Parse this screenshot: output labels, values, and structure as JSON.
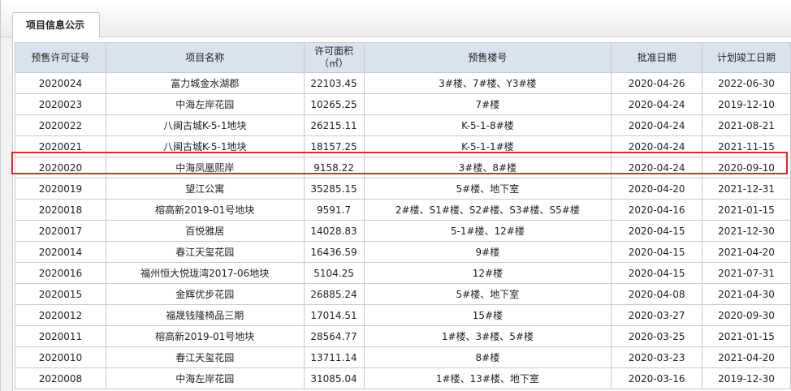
{
  "tab": {
    "label": "项目信息公示"
  },
  "table": {
    "headers": [
      "预售许可证号",
      "项目名称",
      "许可面积\n（㎡）",
      "预售楼号",
      "批准日期",
      "计划竣工日期"
    ],
    "rows": [
      [
        "2020024",
        "富力城金水湖郡",
        "22103.45",
        "3#楼、7#楼、Y3#楼",
        "2020-04-26",
        "2022-06-30"
      ],
      [
        "2020023",
        "中海左岸花园",
        "10265.25",
        "7#楼",
        "2020-04-24",
        "2019-12-10"
      ],
      [
        "2020022",
        "八闽古城K-5-1地块",
        "26215.11",
        "K-5-1-8#楼",
        "2020-04-24",
        "2021-08-21"
      ],
      [
        "2020021",
        "八闽古城K-5-1地块",
        "18157.25",
        "K-5-1-1#楼",
        "2020-04-24",
        "2021-11-15"
      ],
      [
        "2020020",
        "中海凤凰熙岸",
        "9158.22",
        "3#楼、8#楼",
        "2020-04-24",
        "2020-09-10"
      ],
      [
        "2020019",
        "望江公寓",
        "35285.15",
        "5#楼、地下室",
        "2020-04-20",
        "2021-12-31"
      ],
      [
        "2020018",
        "榕高新2019-01号地块",
        "9591.7",
        "2#楼、S1#楼、S2#楼、S3#楼、S5#楼",
        "2020-04-16",
        "2021-01-15"
      ],
      [
        "2020017",
        "百悦雅居",
        "14028.83",
        "5-1#楼、12#楼",
        "2020-04-15",
        "2021-12-30"
      ],
      [
        "2020014",
        "春江天玺花园",
        "16436.59",
        "9#楼",
        "2020-04-15",
        "2021-04-20"
      ],
      [
        "2020016",
        "福州恒大悦珑湾2017-06地块",
        "5104.25",
        "12#楼",
        "2020-04-15",
        "2021-07-31"
      ],
      [
        "2020015",
        "金辉优步花园",
        "26885.24",
        "5#楼、地下室",
        "2020-04-08",
        "2021-04-30"
      ],
      [
        "2020012",
        "福晟钱隆椅品三期",
        "17014.51",
        "15#楼",
        "2020-03-27",
        "2020-09-30"
      ],
      [
        "2020011",
        "榕高新2019-01号地块",
        "28564.77",
        "1#楼、3#楼、5#楼",
        "2020-03-25",
        "2021-01-15"
      ],
      [
        "2020010",
        "春江天玺花园",
        "13711.14",
        "8#楼",
        "2020-03-23",
        "2021-04-20"
      ],
      [
        "2020008",
        "中海左岸花园",
        "31085.04",
        "1#楼、13#楼、地下室",
        "2020-03-16",
        "2019-12-30"
      ]
    ]
  },
  "colors": {
    "header_bg": "#d9e3ef",
    "highlight": "#e8262d",
    "border": "#c9c9c9"
  }
}
